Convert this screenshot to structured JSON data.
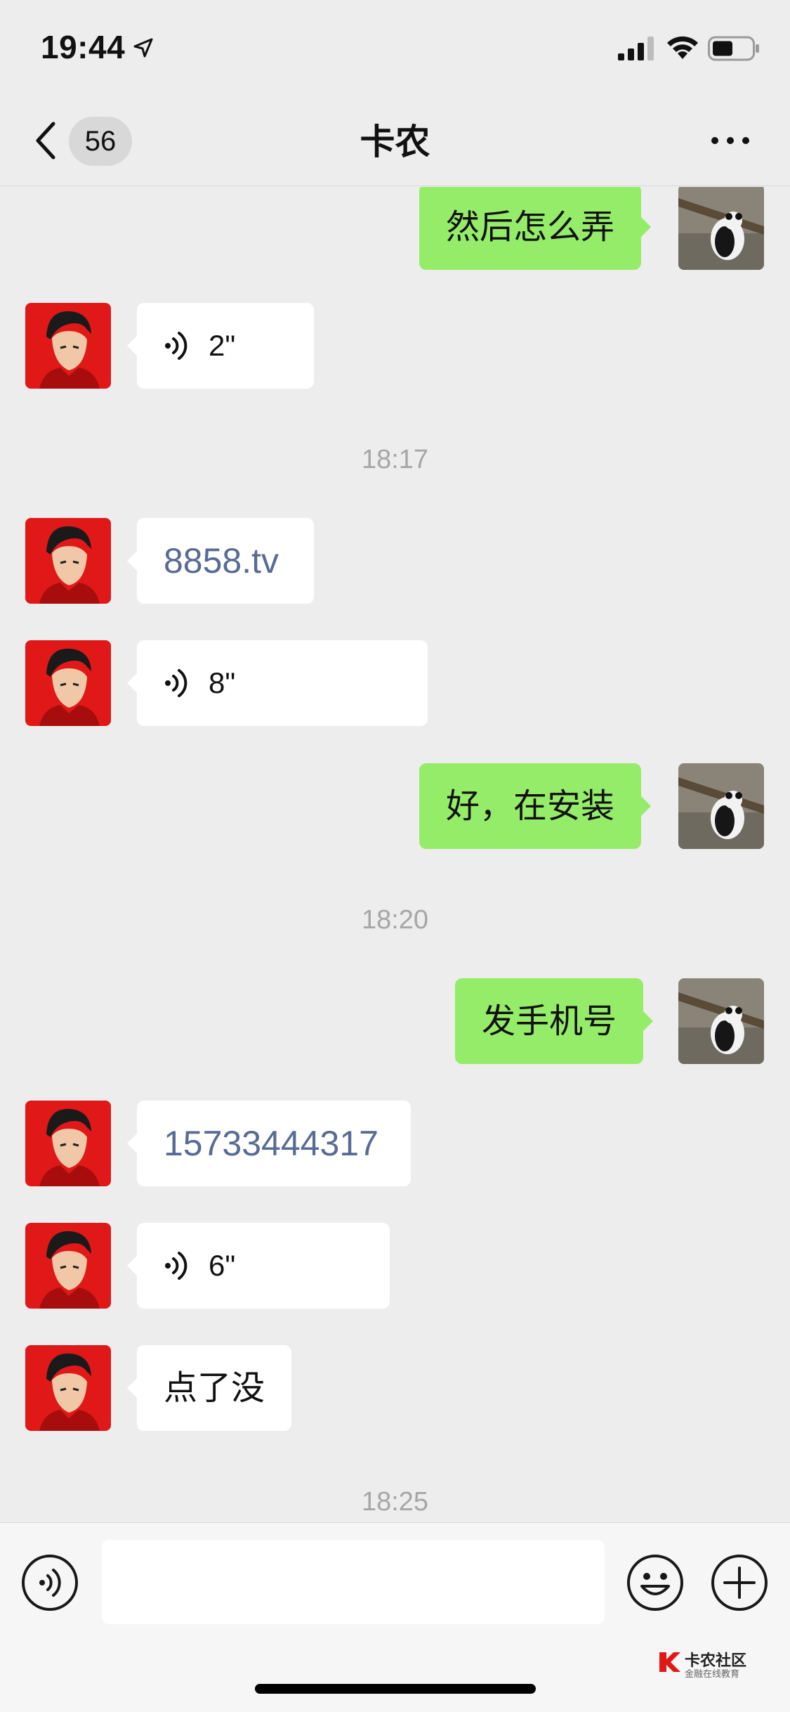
{
  "status_bar": {
    "time": "19:44"
  },
  "nav": {
    "unread_count": "56",
    "title": "卡农"
  },
  "messages": [
    {
      "side": "out",
      "type": "text",
      "text": "然后怎么弄"
    },
    {
      "side": "in",
      "type": "voice",
      "duration": "2\""
    },
    {
      "type": "timestamp",
      "text": "18:17"
    },
    {
      "side": "in",
      "type": "link",
      "text": "8858.tv"
    },
    {
      "side": "in",
      "type": "voice",
      "duration": "8\""
    },
    {
      "side": "out",
      "type": "text",
      "text": "好，在安装"
    },
    {
      "type": "timestamp",
      "text": "18:20"
    },
    {
      "side": "out",
      "type": "text",
      "text": "发手机号"
    },
    {
      "side": "in",
      "type": "link",
      "text": "15733444317"
    },
    {
      "side": "in",
      "type": "voice",
      "duration": "6\""
    },
    {
      "side": "in",
      "type": "text",
      "text": "点了没"
    },
    {
      "type": "timestamp",
      "text": "18:25"
    }
  ],
  "input": {
    "value": "",
    "placeholder": ""
  },
  "watermark": {
    "title": "卡农社区",
    "subtitle": "金融在线教育"
  },
  "colors": {
    "incoming_bubble": "#ffffff",
    "outgoing_bubble": "#95ec69",
    "link": "#576b95",
    "background": "#ededed"
  }
}
